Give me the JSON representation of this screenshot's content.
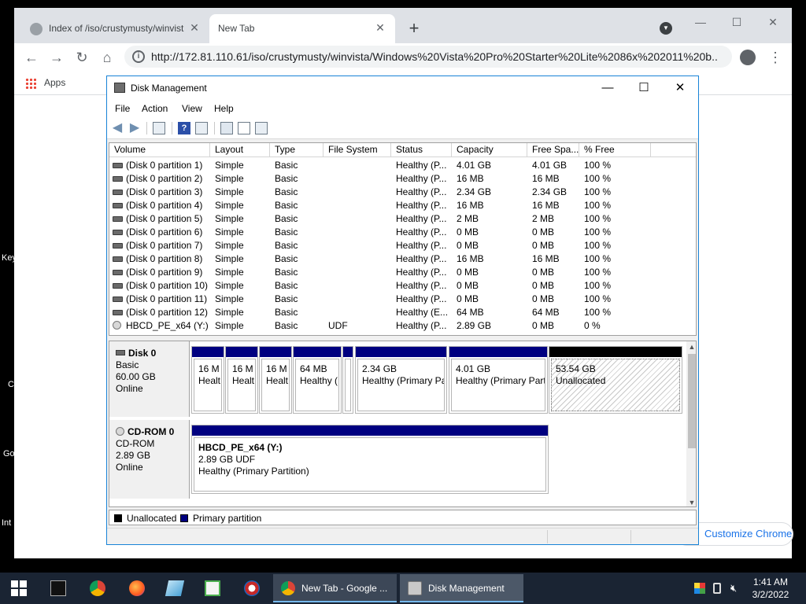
{
  "desktop": {
    "edge_texts": [
      "Key",
      "C",
      "Go",
      "Int"
    ]
  },
  "chrome": {
    "tabs": [
      {
        "title": "Index of /iso/crustymusty/winvista"
      },
      {
        "title": "New Tab"
      }
    ],
    "tab_close": "✕",
    "new_tab": "+",
    "url": "http://172.81.110.61/iso/crustymusty/winvista/Windows%20Vista%20Pro%20Starter%20Lite%2086x%202011%20b...",
    "bookmarks": {
      "apps_label": "Apps"
    },
    "customize_label": "Customize Chrome"
  },
  "disk_mgmt": {
    "title": "Disk Management",
    "menus": [
      "File",
      "Action",
      "View",
      "Help"
    ],
    "columns": [
      "Volume",
      "Layout",
      "Type",
      "File System",
      "Status",
      "Capacity",
      "Free Spa...",
      "% Free"
    ],
    "volumes": [
      {
        "volume": "(Disk 0 partition 1)",
        "layout": "Simple",
        "type": "Basic",
        "fs": "",
        "status": "Healthy (P...",
        "capacity": "4.01 GB",
        "free": "4.01 GB",
        "pct": "100 %",
        "icon": "disk"
      },
      {
        "volume": "(Disk 0 partition 2)",
        "layout": "Simple",
        "type": "Basic",
        "fs": "",
        "status": "Healthy (P...",
        "capacity": "16 MB",
        "free": "16 MB",
        "pct": "100 %",
        "icon": "disk"
      },
      {
        "volume": "(Disk 0 partition 3)",
        "layout": "Simple",
        "type": "Basic",
        "fs": "",
        "status": "Healthy (P...",
        "capacity": "2.34 GB",
        "free": "2.34 GB",
        "pct": "100 %",
        "icon": "disk"
      },
      {
        "volume": "(Disk 0 partition 4)",
        "layout": "Simple",
        "type": "Basic",
        "fs": "",
        "status": "Healthy (P...",
        "capacity": "16 MB",
        "free": "16 MB",
        "pct": "100 %",
        "icon": "disk"
      },
      {
        "volume": "(Disk 0 partition 5)",
        "layout": "Simple",
        "type": "Basic",
        "fs": "",
        "status": "Healthy (P...",
        "capacity": "2 MB",
        "free": "2 MB",
        "pct": "100 %",
        "icon": "disk"
      },
      {
        "volume": "(Disk 0 partition 6)",
        "layout": "Simple",
        "type": "Basic",
        "fs": "",
        "status": "Healthy (P...",
        "capacity": "0 MB",
        "free": "0 MB",
        "pct": "100 %",
        "icon": "disk"
      },
      {
        "volume": "(Disk 0 partition 7)",
        "layout": "Simple",
        "type": "Basic",
        "fs": "",
        "status": "Healthy (P...",
        "capacity": "0 MB",
        "free": "0 MB",
        "pct": "100 %",
        "icon": "disk"
      },
      {
        "volume": "(Disk 0 partition 8)",
        "layout": "Simple",
        "type": "Basic",
        "fs": "",
        "status": "Healthy (P...",
        "capacity": "16 MB",
        "free": "16 MB",
        "pct": "100 %",
        "icon": "disk"
      },
      {
        "volume": "(Disk 0 partition 9)",
        "layout": "Simple",
        "type": "Basic",
        "fs": "",
        "status": "Healthy (P...",
        "capacity": "0 MB",
        "free": "0 MB",
        "pct": "100 %",
        "icon": "disk"
      },
      {
        "volume": "(Disk 0 partition 10)",
        "layout": "Simple",
        "type": "Basic",
        "fs": "",
        "status": "Healthy (P...",
        "capacity": "0 MB",
        "free": "0 MB",
        "pct": "100 %",
        "icon": "disk"
      },
      {
        "volume": "(Disk 0 partition 11)",
        "layout": "Simple",
        "type": "Basic",
        "fs": "",
        "status": "Healthy (P...",
        "capacity": "0 MB",
        "free": "0 MB",
        "pct": "100 %",
        "icon": "disk"
      },
      {
        "volume": "(Disk 0 partition 12)",
        "layout": "Simple",
        "type": "Basic",
        "fs": "",
        "status": "Healthy (E...",
        "capacity": "64 MB",
        "free": "64 MB",
        "pct": "100 %",
        "icon": "disk"
      },
      {
        "volume": "HBCD_PE_x64 (Y:)",
        "layout": "Simple",
        "type": "Basic",
        "fs": "UDF",
        "status": "Healthy (P...",
        "capacity": "2.89 GB",
        "free": "0 MB",
        "pct": "0 %",
        "icon": "cd"
      }
    ],
    "disks": [
      {
        "name": "Disk 0",
        "kind": "Basic",
        "size": "60.00 GB",
        "state": "Online",
        "partitions": [
          {
            "line1": "16 M",
            "line2": "Healt"
          },
          {
            "line1": "16 M",
            "line2": "Healt"
          },
          {
            "line1": "16 M",
            "line2": "Healt"
          },
          {
            "line1": "64 MB",
            "line2": "Healthy ("
          },
          {
            "line1": "",
            "line2": ""
          },
          {
            "line1": "2.34 GB",
            "line2": "Healthy (Primary Pa"
          },
          {
            "line1": "4.01 GB",
            "line2": "Healthy (Primary Part"
          },
          {
            "line1": "53.54 GB",
            "line2": "Unallocated"
          }
        ]
      },
      {
        "name": "CD-ROM 0",
        "kind": "CD-ROM",
        "size": "2.89 GB",
        "state": "Online",
        "partitions": [
          {
            "line0": "HBCD_PE_x64  (Y:)",
            "line1": "2.89 GB UDF",
            "line2": "Healthy (Primary Partition)"
          }
        ]
      }
    ],
    "legend": [
      {
        "label": "Unallocated",
        "color": "#000000"
      },
      {
        "label": "Primary partition",
        "color": "#000080"
      }
    ]
  },
  "taskbar": {
    "tasks": [
      {
        "label": "New Tab - Google ..."
      },
      {
        "label": "Disk Management"
      }
    ],
    "clock": {
      "time": "1:41 AM",
      "date": "3/2/2022"
    }
  },
  "colors": {
    "accent": "#1883d7",
    "partition": "#000080",
    "taskbar": "#1a2433"
  }
}
